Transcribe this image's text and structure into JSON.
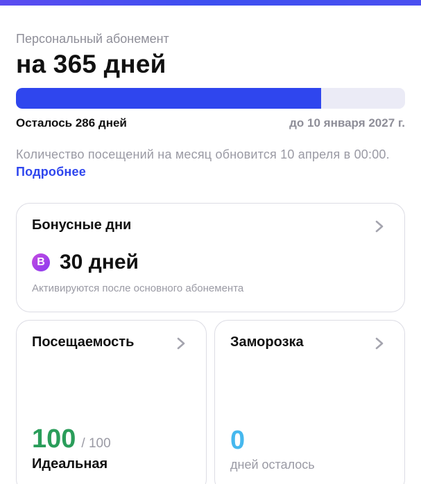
{
  "colors": {
    "accent": "#2f46ee",
    "track": "#ebebf6",
    "green": "#2a9d5a",
    "cyan": "#46b8ee",
    "bonus_badge": "#a943e8"
  },
  "subscription": {
    "subtitle": "Персональный абонемент",
    "title": "на 365 дней",
    "progress_fraction": 0.784,
    "remaining": "Осталось 286 дней",
    "until": "до 10 января 2027 г.",
    "info": "Количество посещений на месяц обновится 10 апреля в 00:00.",
    "info_link": "Подробнее"
  },
  "bonus": {
    "title": "Бонусные дни",
    "badge": "B",
    "value": "30 дней",
    "note": "Активируются после основного абонемента",
    "chevron_icon": "chevron-right-icon"
  },
  "attendance": {
    "title": "Посещаемость",
    "value": "100",
    "max": "/ 100",
    "label": "Идеальная",
    "chevron_icon": "chevron-right-icon"
  },
  "freeze": {
    "title": "Заморозка",
    "value": "0",
    "label": "дней осталось",
    "chevron_icon": "chevron-right-icon"
  }
}
